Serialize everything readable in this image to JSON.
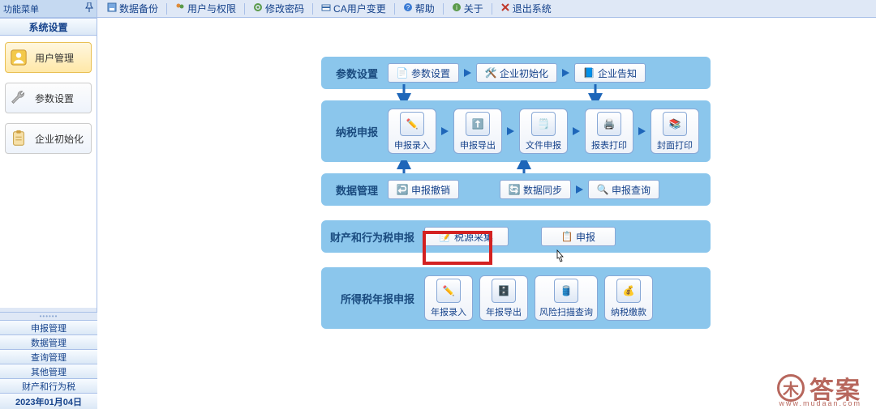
{
  "sidebar": {
    "header": "功能菜单",
    "section": "系统设置",
    "items": [
      {
        "label": "用户管理"
      },
      {
        "label": "参数设置"
      },
      {
        "label": "企业初始化"
      }
    ],
    "collapsed": [
      "申报管理",
      "数据管理",
      "查询管理",
      "其他管理",
      "财产和行为税"
    ],
    "date": "2023年01月04日"
  },
  "toolbar": {
    "items": [
      "数据备份",
      "用户与权限",
      "修改密码",
      "CA用户变更",
      "帮助",
      "关于",
      "退出系统"
    ]
  },
  "flow": {
    "p1": {
      "title": "参数设置",
      "btns": [
        "参数设置",
        "企业初始化",
        "企业告知"
      ]
    },
    "p2": {
      "title": "纳税申报",
      "btns": [
        "申报录入",
        "申报导出",
        "文件申报",
        "报表打印",
        "封面打印"
      ]
    },
    "p3": {
      "title": "数据管理",
      "btns": [
        "申报撤销",
        "数据同步",
        "申报查询"
      ]
    },
    "p4": {
      "title": "财产和行为税申报",
      "btns": [
        "税源采集",
        "申报"
      ]
    },
    "p5": {
      "title": "所得税年报申报",
      "btns": [
        "年报录入",
        "年报导出",
        "风险扫描查询",
        "纳税缴款"
      ]
    }
  },
  "watermark": {
    "icon": "木",
    "text": "答案",
    "sub": "www.mudaan.com"
  }
}
